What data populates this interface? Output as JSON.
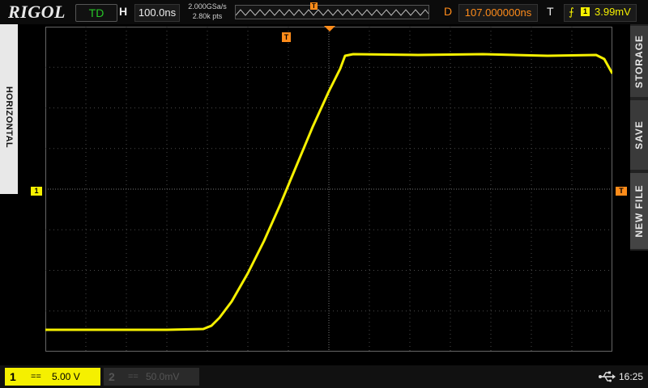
{
  "top": {
    "brand": "RIGOL",
    "run_status": "TD",
    "horizontal_label": "H",
    "timebase": "100.0ns",
    "sample_rate": "2.000GSa/s",
    "memory_depth": "2.80k pts",
    "delay_label": "D",
    "delay": "107.000000ns",
    "trigger_label": "T",
    "trigger_source": "1",
    "trigger_level": "3.99mV",
    "trigger_position_marker": "T"
  },
  "left_panel": {
    "label": "HORIZONTAL"
  },
  "right_panel": {
    "buttons": [
      "STORAGE",
      "SAVE",
      "NEW FILE"
    ]
  },
  "markers": {
    "ch1_offset": "1",
    "trigger_level_marker": "T"
  },
  "bottom": {
    "ch1": {
      "number": "1",
      "coupling": "==",
      "scale": "5.00 V"
    },
    "ch2": {
      "number": "2",
      "coupling": "==",
      "scale": "50.0mV"
    },
    "time": "16:25"
  },
  "colors": {
    "ch1": "#f5f000",
    "trigger": "#ff8c1a",
    "run": "#27c427",
    "grid": "#4a4a4a"
  }
}
